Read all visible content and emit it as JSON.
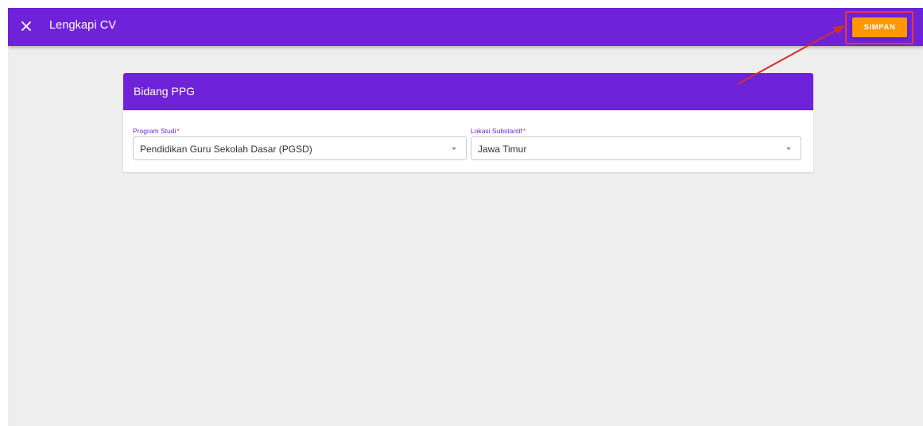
{
  "appbar": {
    "title": "Lengkapi CV",
    "close_icon": "close-icon",
    "save_label": "SIMPAN"
  },
  "card": {
    "title": "Bidang PPG",
    "fields": [
      {
        "label": "Program Studi",
        "required_mark": "*",
        "value": "Pendidikan Guru Sekolah Dasar (PGSD)"
      },
      {
        "label": "Lokasi Substantif",
        "required_mark": "*",
        "value": "Jawa Timur"
      }
    ]
  },
  "colors": {
    "primary": "#6f23d9",
    "save_button": "#ff9800",
    "highlight": "#e53935",
    "background": "#eeeeee"
  }
}
